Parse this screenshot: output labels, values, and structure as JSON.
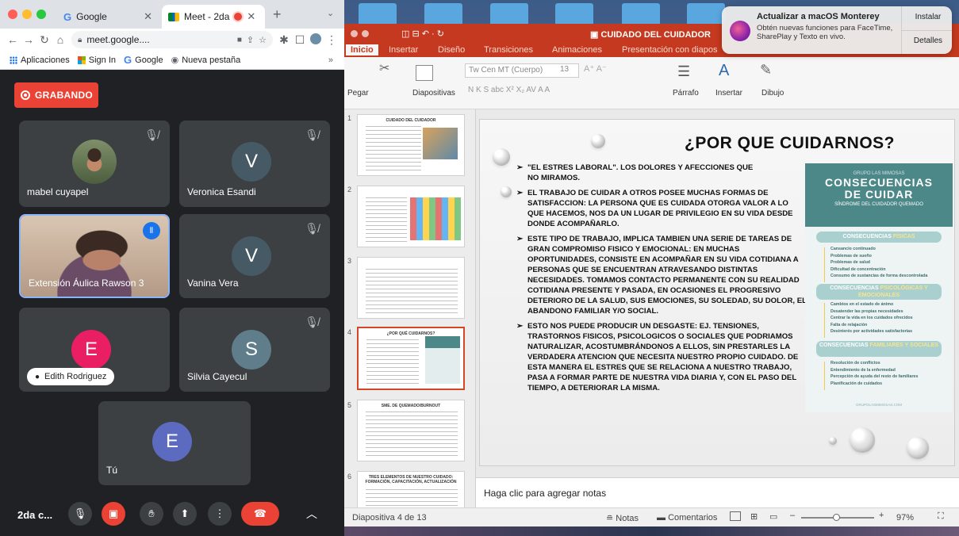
{
  "chrome": {
    "tabs": [
      {
        "label": "Google"
      },
      {
        "label": "Meet - 2da"
      }
    ],
    "url": "meet.google....",
    "bookmarks": [
      {
        "label": "Aplicaciones"
      },
      {
        "label": "Sign In"
      },
      {
        "label": "Google"
      },
      {
        "label": "Nueva pestaña"
      }
    ],
    "bookmarks_more": "»"
  },
  "meet": {
    "recording_label": "GRABANDO",
    "participants": [
      {
        "name": "mabel cuyapel"
      },
      {
        "name": "Veronica Esandi",
        "initial": "V",
        "color": "#455a64"
      },
      {
        "name": "Extensión Áulica Rawson 3"
      },
      {
        "name": "Vanina Vera",
        "initial": "V",
        "color": "#455a64"
      },
      {
        "name": "Edith Rodriguez",
        "initial": "E",
        "color": "#e91e63"
      },
      {
        "name": "Silvia Cayecul",
        "initial": "S",
        "color": "#607d8b"
      },
      {
        "name": "Tú",
        "initial": "E",
        "color": "#5c6bc0"
      }
    ],
    "meeting_name": "2da c..."
  },
  "notification": {
    "title": "Actualizar a macOS Monterey",
    "body": "Obtén nuevas funciones para FaceTime, SharePlay y Texto en vivo.",
    "install": "Instalar",
    "details": "Detalles"
  },
  "ppt": {
    "doc_title": "CUIDADO DEL CUIDADOR",
    "tabs": [
      "Inicio",
      "Insertar",
      "Diseño",
      "Transiciones",
      "Animaciones",
      "Presentación con diapos"
    ],
    "ribbon": {
      "paste": "Pegar",
      "slides": "Diapositivas",
      "font": "Tw Cen MT (Cuerpo)",
      "size": "13",
      "paragraph": "Párrafo",
      "insert": "Insertar",
      "draw": "Dibujo"
    },
    "thumbnails": [
      {
        "num": "1",
        "title": "CUIDADO DEL CUIDADOR"
      },
      {
        "num": "2",
        "title": ""
      },
      {
        "num": "3",
        "title": ""
      },
      {
        "num": "4",
        "title": "¿POR QUÉ CUIDARNOS?"
      },
      {
        "num": "5",
        "title": "SME. DE QUEMADO/BURNOUT"
      },
      {
        "num": "6",
        "title": "TRES ELEMENTOS DE NUESTRO CUIDADO: FORMACIÓN, CAPACITACIÓN, ACTUALIZACIÓN"
      }
    ],
    "slide": {
      "title": "¿POR QUE CUIDARNOS?",
      "bullets": [
        "\"EL ESTRES LABORAL\". LOS DOLORES Y AFECCIONES QUE NO MIRAMOS.",
        "EL TRABAJO DE CUIDAR A OTROS POSEE MUCHAS FORMAS DE SATISFACCION: LA PERSONA QUE ES CUIDADA OTORGA VALOR A LO QUE HACEMOS, NOS DA UN LUGAR DE PRIVILEGIO EN SU VIDA DESDE DONDE ACOMPAÑARLO.",
        "ESTE TIPO DE TRABAJO, IMPLICA TAMBIEN UNA SERIE DE TAREAS DE GRAN COMPROMISO FISICO Y EMOCIONAL: EN MUCHAS OPORTUNIDADES, CONSISTE EN ACOMPAÑAR EN SU VIDA COTIDIANA A PERSONAS QUE SE ENCUENTRAN ATRAVESANDO DISTINTAS NECESIDADES. TOMAMOS CONTACTO PERMANENTE CON SU REALIDAD COTIDIANA PRESENTE Y PASADA, EN OCASIONES EL PROGRESIVO DETERIORO DE LA SALUD, SUS EMOCIONES, SU SOLEDAD, SU DOLOR, EL ABANDONO FAMILIAR Y/O SOCIAL.",
        "ESTO NOS PUEDE PRODUCIR UN DESGASTE: EJ. TENSIONES, TRASTORNOS FISICOS, PSICOLOGICOS O SOCIALES QUE PODRIAMOS NATURALIZAR, ACOSTUMBRÁNDONOS A ELLOS, SIN PRESTARLES LA VERDADERA ATENCION QUE NECESITA NUESTRO PROPIO CUIDADO. DE ESTA MANERA EL ESTRES QUE SE RELACIONA A NUESTRO TRABAJO, PASA A FORMAR PARTE DE NUESTRA VIDA DIARIA Y, CON EL PASO DEL TIEMPO, A DETERIORAR LA MISMA."
      ],
      "infographic": {
        "org": "GRUPO LAS MIMOSAS",
        "title1": "CONSECUENCIAS",
        "title2": "DE CUIDAR",
        "subtitle": "SÍNDROME DEL CUIDADOR QUEMADO",
        "sec1_a": "CONSECUENCIAS",
        "sec1_b": "FÍSICAS",
        "sec1_items": [
          "Cansancio continuado",
          "Problemas de sueño",
          "Problemas de salud",
          "Dificultad de concentración",
          "Consumo de sustancias de forma descontrolada"
        ],
        "sec2_a": "CONSECUENCIAS",
        "sec2_b": "PSICOLÓGICAS Y EMOCIONALES",
        "sec2_items": [
          "Cambios en el estado de ánimo",
          "Desatender las propias necesidades",
          "Centrar la vida en los cuidados ofrecidos",
          "Falta de relajación",
          "Desinterés por actividades satisfactorias"
        ],
        "sec3_a": "CONSECUENCIAS",
        "sec3_b": "FAMILIARES Y SOCIALES",
        "sec3_items": [
          "Resolución de conflictos",
          "Entendimiento de la enfermedad",
          "Percepción de ayuda del resto de familiares",
          "Planificación de cuidados"
        ],
        "footer": "GRUPOLASMIMOSAS.COM"
      }
    },
    "notes_placeholder": "Haga clic para agregar notas",
    "status": {
      "slide_info": "Diapositiva 4 de 13",
      "notes": "Notas",
      "comments": "Comentarios",
      "zoom": "97%"
    }
  }
}
